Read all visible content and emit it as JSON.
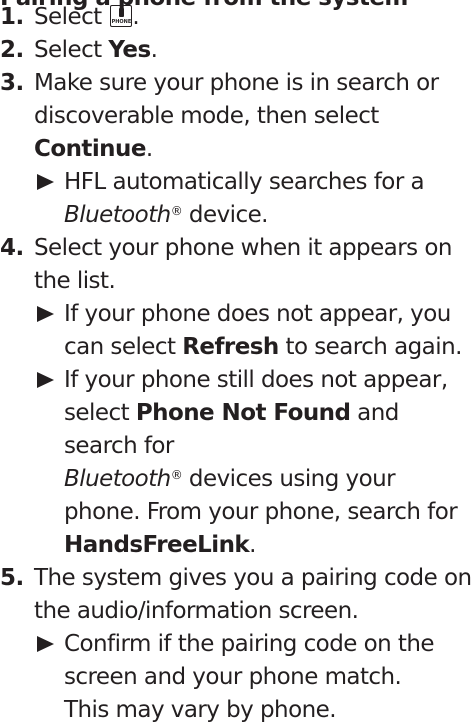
{
  "heading": "Pairing a phone from the system",
  "steps": [
    {
      "num": "1.",
      "before": "Select ",
      "icon_text": "PHONE",
      "icon": "phone-button-icon",
      "after": "."
    },
    {
      "num": "2.",
      "text": "Select ",
      "bold": "Yes",
      "after": "."
    },
    {
      "num": "3.",
      "text": "Make sure your phone is in search or discoverable mode, then select ",
      "bold": "Continue",
      "after": ".",
      "subs": [
        {
          "prefix": "HFL automatically searches for a ",
          "italic": "Bluetooth",
          "reg": "®",
          "suffix": " device."
        }
      ]
    },
    {
      "num": "4.",
      "text": "Select your phone when it appears on the list.",
      "subs": [
        {
          "prefix": "If your phone does not appear, you can select ",
          "bold": "Refresh",
          "suffix": " to search again."
        },
        {
          "prefix": "If your phone still does not appear, select ",
          "bold": "Phone Not Found",
          "mid": " and search for ",
          "italic": "Bluetooth",
          "reg": "®",
          "mid2": " devices using your phone. From your phone, search for ",
          "bold2": "HandsFreeLink",
          "suffix": "."
        }
      ]
    },
    {
      "num": "5.",
      "text": "The system gives you a pairing code on the audio/information screen.",
      "subs": [
        {
          "prefix": "Confirm if the pairing code on the screen and your phone match.",
          "line2": "This may vary by phone."
        }
      ]
    }
  ]
}
